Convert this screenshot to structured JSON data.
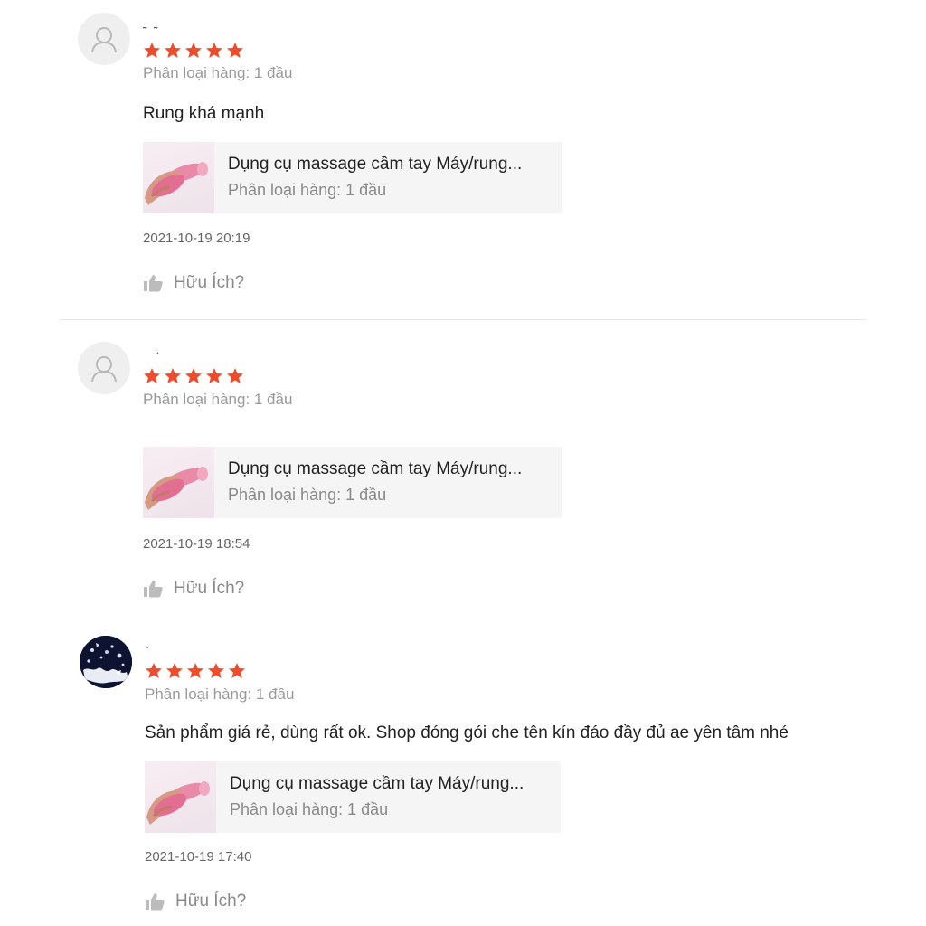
{
  "reviews": [
    {
      "username": "˜  ˜",
      "avatar": "default-user-icon",
      "rating": 5,
      "variant": "Phân loại hàng: 1 đầu",
      "comment": "Rung khá mạnh",
      "product": {
        "name": "Dụng cụ massage cầm tay Máy/rung...",
        "variant": "Phân loại hàng: 1 đầu"
      },
      "timestamp": "2021-10-19 20:19",
      "helpful_label": "Hữu Ích?"
    },
    {
      "username": "ˊ",
      "avatar": "default-user-icon",
      "rating": 5,
      "variant": "Phân loại hàng: 1 đầu",
      "comment": "",
      "product": {
        "name": "Dụng cụ massage cầm tay Máy/rung...",
        "variant": "Phân loại hàng: 1 đầu"
      },
      "timestamp": "2021-10-19 18:54",
      "helpful_label": "Hữu Ích?"
    },
    {
      "username": "ˇ",
      "avatar": "photo",
      "rating": 5,
      "variant": "Phân loại hàng: 1 đầu",
      "comment": "Sản phẩm giá rẻ, dùng rất ok. Shop đóng gói che tên kín đáo đầy đủ ae yên tâm nhé",
      "product": {
        "name": "Dụng cụ massage cầm tay Máy/rung...",
        "variant": "Phân loại hàng: 1 đầu"
      },
      "timestamp": "2021-10-19 17:40",
      "helpful_label": "Hữu Ích?"
    }
  ],
  "colors": {
    "star": "#ee4d2d",
    "divider": "#e6e6e6",
    "card_bg": "#f5f5f5"
  }
}
